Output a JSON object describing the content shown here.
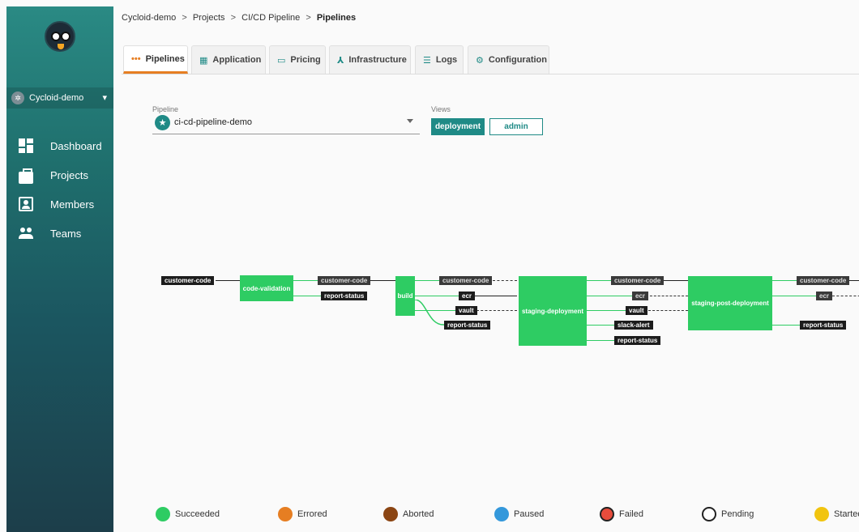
{
  "sidebar": {
    "org": {
      "name": "Cycloid-demo",
      "icon": "org-icon"
    },
    "items": [
      {
        "label": "Dashboard",
        "icon": "dashboard-icon"
      },
      {
        "label": "Projects",
        "icon": "briefcase-icon"
      },
      {
        "label": "Members",
        "icon": "members-icon"
      },
      {
        "label": "Teams",
        "icon": "teams-icon"
      }
    ]
  },
  "breadcrumb": {
    "parts": [
      "Cycloid-demo",
      "Projects",
      "CI/CD Pipeline"
    ],
    "current": "Pipelines",
    "separator": ">"
  },
  "tabs": [
    {
      "label": "Pipelines",
      "icon": "pipeline-icon",
      "active": true
    },
    {
      "label": "Application",
      "icon": "application-icon"
    },
    {
      "label": "Pricing",
      "icon": "credit-card-icon"
    },
    {
      "label": "Infrastructure",
      "icon": "infrastructure-icon"
    },
    {
      "label": "Logs",
      "icon": "logs-icon"
    },
    {
      "label": "Configuration",
      "icon": "gear-icon"
    }
  ],
  "pipeline_selector": {
    "label": "Pipeline",
    "value": "ci-cd-pipeline-demo"
  },
  "views": {
    "label": "Views",
    "options": [
      "deployment",
      "admin"
    ],
    "selected": "deployment"
  },
  "graph": {
    "jobs": [
      "code-validation",
      "build",
      "staging-deployment",
      "staging-post-deployment"
    ],
    "resources": {
      "r1": "customer-code",
      "r2": "customer-code",
      "r3": "report-status",
      "r4": "customer-code",
      "r5": "ecr",
      "r6": "vault",
      "r7": "report-status",
      "r8": "customer-code",
      "r9": "ecr",
      "r10": "vault",
      "r11": "slack-alert",
      "r12": "report-status",
      "r13": "customer-code",
      "r14": "ecr",
      "r15": "report-status"
    }
  },
  "legend": [
    {
      "label": "Succeeded",
      "color": "#2ecc63"
    },
    {
      "label": "Errored",
      "color": "#e67e22"
    },
    {
      "label": "Aborted",
      "color": "#8b4513"
    },
    {
      "label": "Paused",
      "color": "#3498db"
    },
    {
      "label": "Failed",
      "color": "#e74c3c"
    },
    {
      "label": "Pending",
      "color": "#ffffff"
    },
    {
      "label": "Started",
      "color": "#f1c40f"
    }
  ],
  "colors": {
    "accent": "#1f8a86",
    "active_tab": "#e67e22",
    "job": "#2ecc63"
  }
}
